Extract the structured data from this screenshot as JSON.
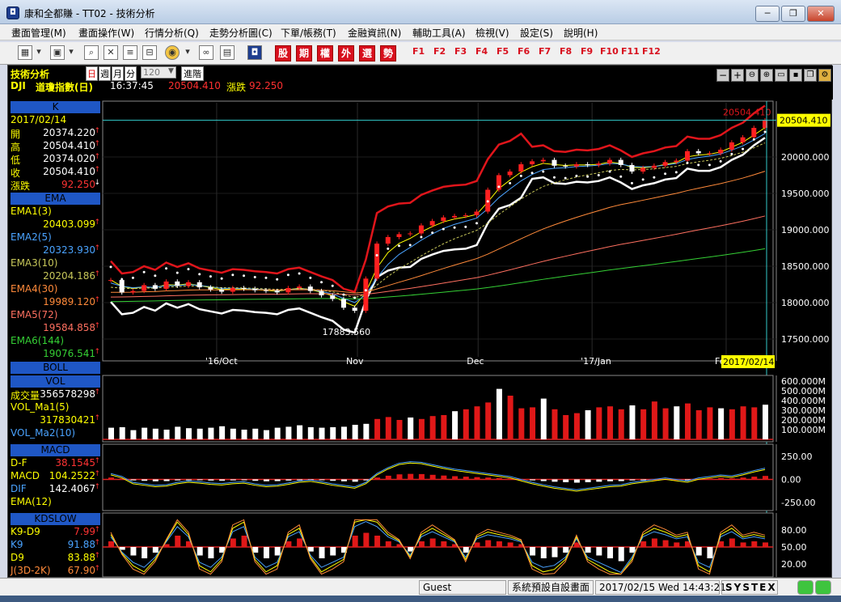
{
  "window": {
    "title": "康和全都賺 - TT02 - 技術分析",
    "app_icon": "logo-icon"
  },
  "window_buttons": [
    "─",
    "❐",
    "✕"
  ],
  "menubar": [
    "畫面管理(M)",
    "畫面操作(W)",
    "行情分析(Q)",
    "走勢分析圖(C)",
    "下單/帳務(T)",
    "金融資訊(N)",
    "輔助工具(A)",
    "檢視(V)",
    "設定(S)",
    "說明(H)"
  ],
  "toolbar": {
    "red_buttons": [
      "股",
      "期",
      "權",
      "外",
      "選",
      "勢"
    ],
    "fkeys": [
      "F1",
      "F2",
      "F3",
      "F4",
      "F5",
      "F6",
      "F7",
      "F8",
      "F9",
      "F10",
      "F11",
      "F12"
    ]
  },
  "header": {
    "title": "技術分析",
    "period_day": "日",
    "period_week": "週",
    "period_month": "月",
    "period_min": "分",
    "count": "120",
    "advanced": "進階",
    "symbol": "DJI",
    "name": "道瓊指數(日)",
    "time": "16:37:45",
    "price": "20504.410",
    "change_label": "漲跌",
    "change": "92.250"
  },
  "left_panels": {
    "k": {
      "title": "K",
      "date": "2017/02/14",
      "rows": [
        {
          "label": "開",
          "value": "20374.220"
        },
        {
          "label": "高",
          "value": "20504.410"
        },
        {
          "label": "低",
          "value": "20374.020"
        },
        {
          "label": "收",
          "value": "20504.410"
        },
        {
          "label": "漲跌",
          "value": "92.250"
        }
      ]
    },
    "ema": {
      "title": "EMA",
      "rows": [
        {
          "label": "EMA1(3)",
          "value": "20403.099",
          "color": "#ffff00"
        },
        {
          "label": "EMA2(5)",
          "value": "20323.930",
          "color": "#4aa3ff"
        },
        {
          "label": "EMA3(10)",
          "value": "20204.186",
          "color": "#c8c85a"
        },
        {
          "label": "EMA4(30)",
          "value": "19989.120",
          "color": "#ff8a3a"
        },
        {
          "label": "EMA5(72)",
          "value": "19584.858",
          "color": "#ff7060"
        },
        {
          "label": "EMA6(144)",
          "value": "19076.541",
          "color": "#35d035"
        }
      ]
    },
    "boll": {
      "title": "BOLL"
    },
    "vol": {
      "title": "VOL",
      "rows": [
        {
          "label": "成交量",
          "value": "356578298"
        },
        {
          "label": "VOL_Ma1(5)",
          "value": ""
        },
        {
          "label": "",
          "value": "317830421"
        },
        {
          "label": "VOL_Ma2(10)",
          "value": ""
        }
      ]
    },
    "macd": {
      "title": "MACD",
      "rows": [
        {
          "label": "D-F",
          "value": "38.1545"
        },
        {
          "label": "MACD",
          "value": "104.2522"
        },
        {
          "label": "DIF",
          "value": "142.4067"
        },
        {
          "label": "EMA(12)",
          "value": ""
        }
      ]
    },
    "kd": {
      "title": "KDSLOW",
      "rows": [
        {
          "label": "K9-D9",
          "value": "7.99"
        },
        {
          "label": "K9",
          "value": "91.88"
        },
        {
          "label": "D9",
          "value": "83.88"
        },
        {
          "label": "J(3D-2K)",
          "value": "67.90"
        }
      ]
    }
  },
  "chart_data": [
    {
      "type": "line",
      "title": "",
      "ylim": [
        17300,
        20700
      ],
      "yticks": [
        "20000.000",
        "19500.000",
        "19000.000",
        "18500.000",
        "18000.000",
        "17500.000"
      ],
      "xticks": [
        "'16/Oct",
        "Nov",
        "Dec",
        "'17/Jan",
        "Feb"
      ],
      "current_price_label": "20504.410",
      "high_label": "20504.410",
      "low_label": "17883.560",
      "cursor_date": "2017/02/14",
      "series": [
        {
          "name": "close",
          "color": "#ffffff",
          "values": [
            18310,
            18140,
            18160,
            18240,
            18190,
            18290,
            18230,
            18280,
            18210,
            18180,
            18150,
            18200,
            18190,
            18170,
            18160,
            18140,
            18200,
            18220,
            18160,
            18100,
            18050,
            17930,
            17888,
            18330,
            18810,
            18900,
            18940,
            18950,
            19060,
            19120,
            19170,
            19190,
            19200,
            19250,
            19550,
            19750,
            19800,
            19900,
            19940,
            19960,
            19880,
            19870,
            19900,
            19890,
            19910,
            19960,
            19890,
            19800,
            19850,
            19880,
            19930,
            19950,
            20080,
            20050,
            20050,
            20100,
            20200,
            20270,
            20400,
            20504
          ]
        }
      ]
    },
    {
      "type": "bar",
      "title": "",
      "ylim": [
        0,
        600
      ],
      "yticks": [
        "600.000M",
        "500.000M",
        "400.000M",
        "300.000M",
        "200.000M",
        "100.000M"
      ],
      "values": [
        120,
        125,
        95,
        120,
        110,
        100,
        130,
        115,
        110,
        120,
        135,
        110,
        100,
        110,
        95,
        120,
        130,
        145,
        125,
        120,
        125,
        130,
        150,
        160,
        210,
        230,
        200,
        225,
        210,
        240,
        250,
        290,
        310,
        340,
        380,
        520,
        450,
        320,
        330,
        420,
        310,
        250,
        270,
        300,
        330,
        340,
        310,
        350,
        310,
        390,
        320,
        340,
        370,
        300,
        330,
        320,
        310,
        340,
        330,
        357
      ]
    },
    {
      "type": "bar",
      "title": "",
      "ylim": [
        -320,
        320
      ],
      "yticks": [
        "250.00",
        "0.00",
        "-250.00"
      ],
      "values": [
        20,
        10,
        -10,
        -15,
        -20,
        -18,
        -10,
        -5,
        -8,
        -12,
        -14,
        -10,
        -8,
        -15,
        -20,
        -18,
        -12,
        -5,
        -2,
        -8,
        -15,
        -20,
        -25,
        -10,
        20,
        40,
        55,
        60,
        58,
        50,
        42,
        35,
        30,
        25,
        20,
        15,
        10,
        0,
        -10,
        -18,
        -25,
        -30,
        -35,
        -30,
        -25,
        -20,
        -18,
        -10,
        -5,
        0,
        5,
        0,
        -5,
        5,
        10,
        15,
        12,
        20,
        30,
        38
      ]
    },
    {
      "type": "bar",
      "title": "",
      "ylim": [
        0,
        100
      ],
      "yticks": [
        "80.00",
        "50.00",
        "20.00"
      ],
      "values": [
        10,
        -5,
        -15,
        -20,
        -10,
        5,
        20,
        10,
        -15,
        -20,
        -10,
        15,
        20,
        -10,
        -20,
        -15,
        10,
        15,
        -8,
        -20,
        -15,
        -10,
        20,
        25,
        20,
        10,
        5,
        -8,
        10,
        15,
        10,
        5,
        -10,
        8,
        12,
        10,
        8,
        5,
        -15,
        -20,
        -18,
        -10,
        8,
        -10,
        -15,
        -20,
        -25,
        -10,
        10,
        15,
        12,
        8,
        10,
        -15,
        -20,
        10,
        15,
        8,
        10,
        8
      ]
    }
  ],
  "statusbar": {
    "user": "Guest",
    "screen": "系統預設自設畫面",
    "datetime": "2017/02/15 Wed 14:43:21",
    "brand": "SYSTEX"
  }
}
